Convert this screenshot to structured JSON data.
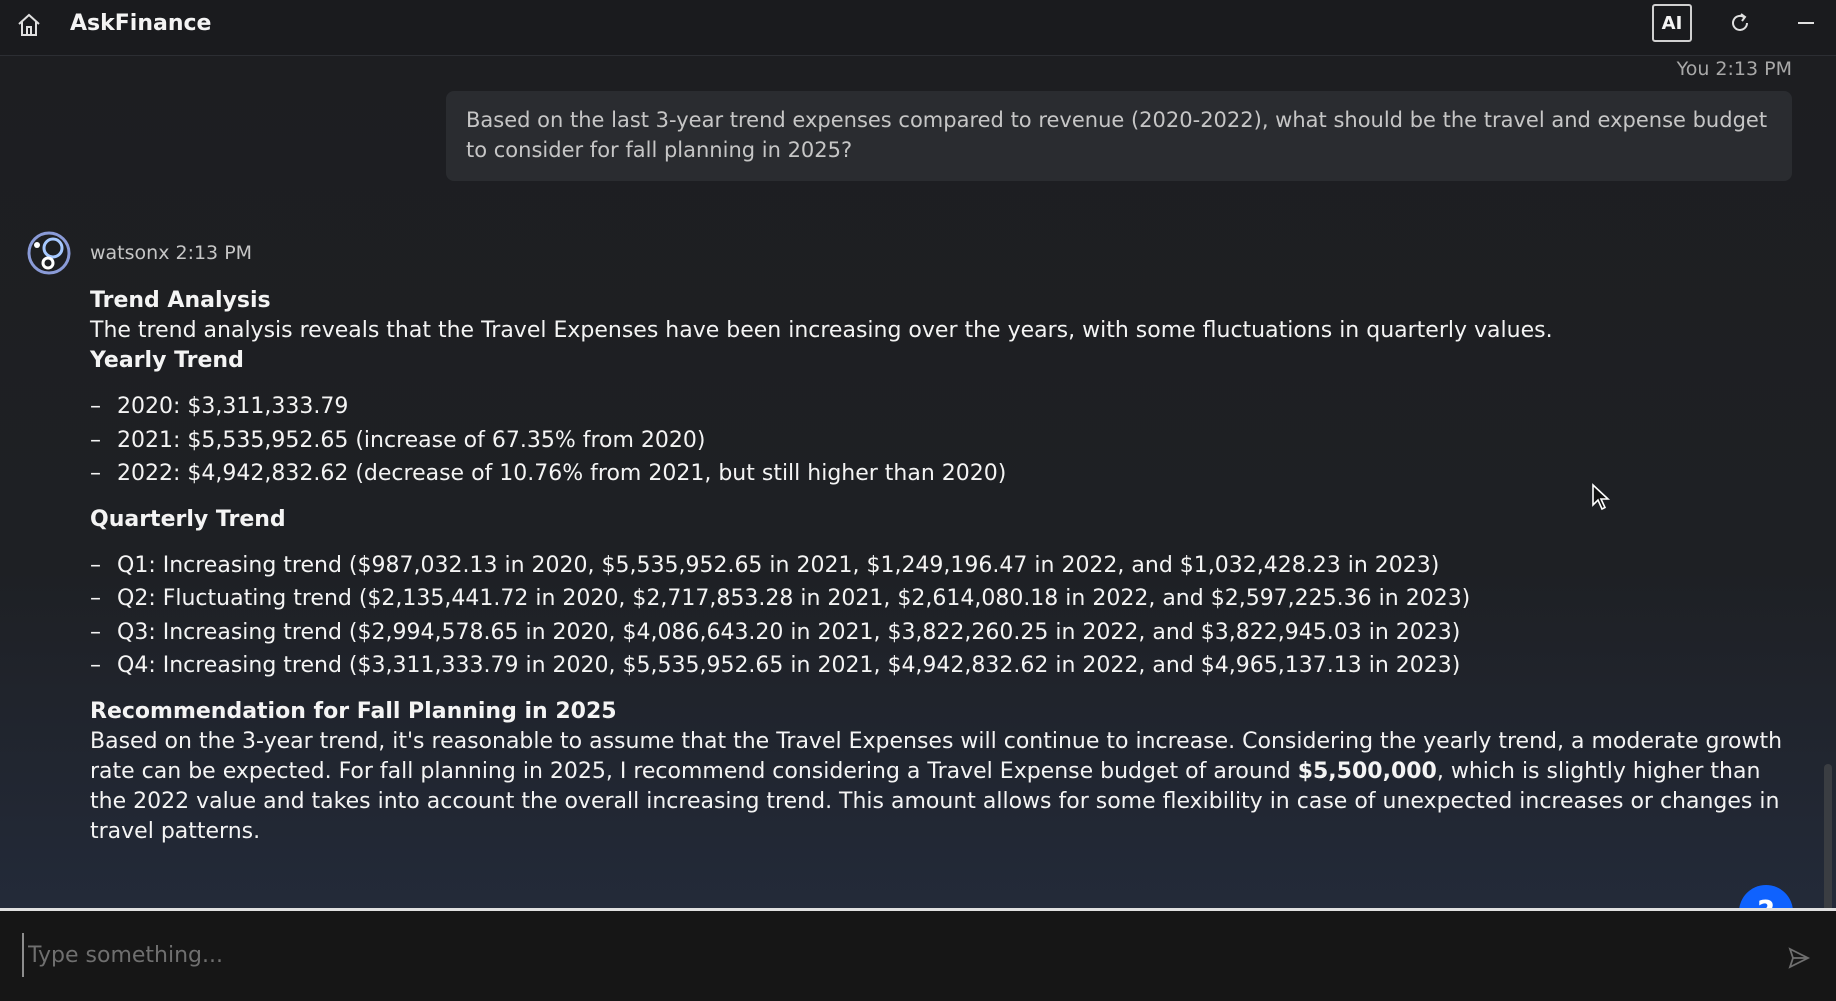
{
  "header": {
    "title": "AskFinance",
    "ai_badge": "AI"
  },
  "user_message": {
    "meta": "You 2:13 PM",
    "text": "Based on the last 3-year trend expenses compared to revenue (2020-2022), what should be the travel and expense budget to consider for fall planning in 2025?"
  },
  "bot_message": {
    "meta": "watsonx 2:13 PM",
    "trend_heading": "Trend Analysis",
    "trend_text": "The trend analysis reveals that the Travel Expenses have been increasing over the years, with some fluctuations in quarterly values.",
    "yearly_heading": "Yearly Trend",
    "yearly_items": [
      "2020: $3,311,333.79",
      "2021: $5,535,952.65 (increase of 67.35% from 2020)",
      "2022: $4,942,832.62 (decrease of 10.76% from 2021, but still higher than 2020)"
    ],
    "quarterly_heading": "Quarterly Trend",
    "quarterly_items": [
      "Q1: Increasing trend ($987,032.13 in 2020, $5,535,952.65 in 2021, $1,249,196.47 in 2022, and $1,032,428.23 in 2023)",
      "Q2: Fluctuating trend ($2,135,441.72 in 2020, $2,717,853.28 in 2021, $2,614,080.18 in 2022, and $2,597,225.36 in 2023)",
      "Q3: Increasing trend ($2,994,578.65 in 2020, $4,086,643.20 in 2021, $3,822,260.25 in 2022, and $3,822,945.03 in 2023)",
      "Q4: Increasing trend ($3,311,333.79 in 2020, $5,535,952.65 in 2021, $4,942,832.62 in 2022, and $4,965,137.13 in 2023)"
    ],
    "rec_heading": "Recommendation for Fall Planning in 2025",
    "rec_text_before": "Based on the 3-year trend, it's reasonable to assume that the Travel Expenses will continue to increase. Considering the yearly trend, a moderate growth rate can be expected. For fall planning in 2025, I recommend considering a Travel Expense budget of around ",
    "rec_text_bold": "$5,500,000",
    "rec_text_after": ", which is slightly higher than the 2022 value and takes into account the overall increasing trend. This amount allows for some flexibility in case of unexpected increases or changes in travel patterns."
  },
  "help": {
    "label": "?"
  },
  "input": {
    "placeholder": "Type something..."
  },
  "colors": {
    "accent": "#0f62fe",
    "background": "#1c1d20",
    "bubble": "#2a2c30"
  },
  "icons": [
    "home-icon",
    "refresh-icon",
    "minimize-icon",
    "bot-avatar-icon",
    "send-icon",
    "mouse-cursor-icon"
  ]
}
